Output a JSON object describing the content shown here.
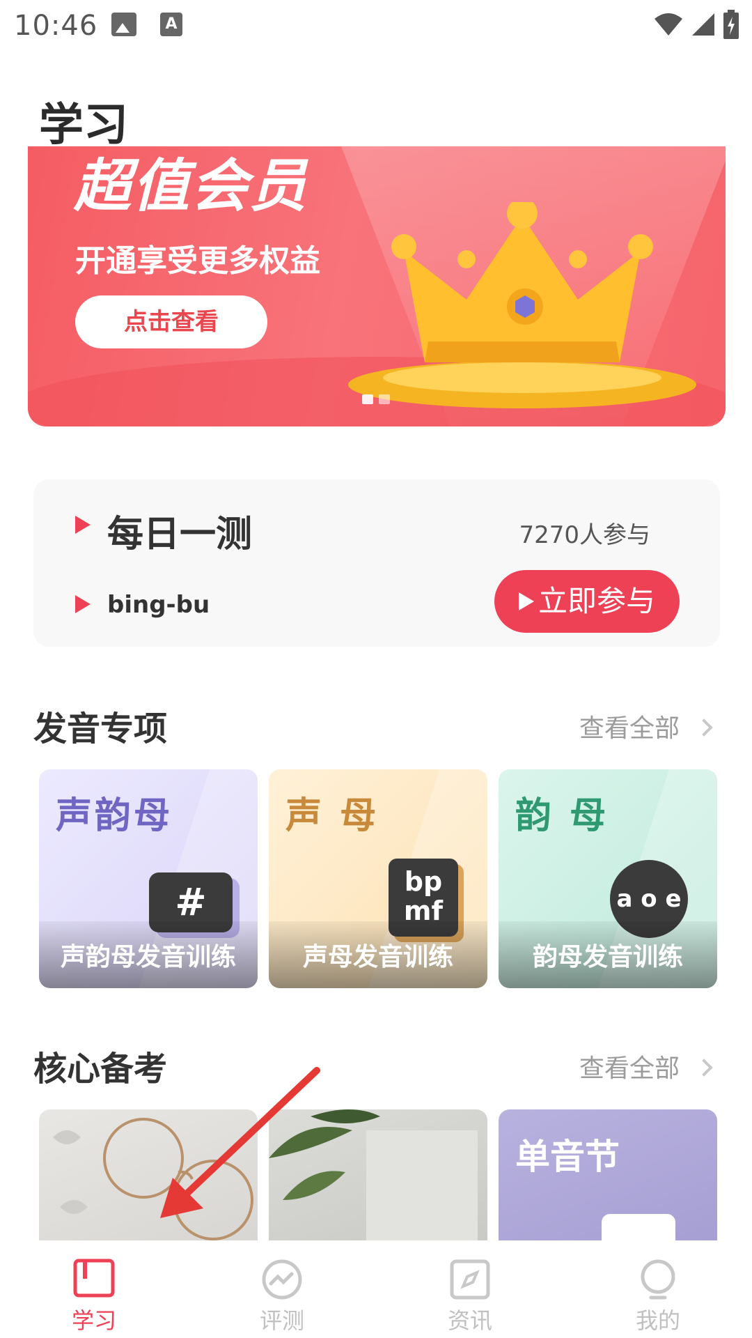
{
  "status_bar": {
    "time": "10:46"
  },
  "page": {
    "title": "学习"
  },
  "banner": {
    "headline": "超值会员",
    "subtitle": "开通享受更多权益",
    "button_label": "点击查看"
  },
  "daily_test": {
    "title": "每日一测",
    "participants": "7270人参与",
    "word": "bing-bu",
    "join_label": "立即参与"
  },
  "pronunciation": {
    "title": "发音专项",
    "more_label": "查看全部",
    "cards": [
      {
        "title": "声韵母",
        "badge": "#",
        "label": "声韵母发音训练"
      },
      {
        "title": "声 母",
        "badge_line1": "bp",
        "badge_line2": "mf",
        "label": "声母发音训练"
      },
      {
        "title": "韵 母",
        "badge": "a o e",
        "label": "韵母发音训练"
      }
    ]
  },
  "exam_prep": {
    "title": "核心备考",
    "more_label": "查看全部",
    "cards": [
      {
        "title": ""
      },
      {
        "title": ""
      },
      {
        "title": "单音节"
      }
    ]
  },
  "bottom_nav": {
    "items": [
      {
        "label": "学习",
        "icon": "study-book-icon",
        "active": true
      },
      {
        "label": "评测",
        "icon": "evaluation-chart-icon",
        "active": false
      },
      {
        "label": "资讯",
        "icon": "compass-news-icon",
        "active": false
      },
      {
        "label": "我的",
        "icon": "profile-bulb-icon",
        "active": false
      }
    ]
  },
  "colors": {
    "accent": "#ee4155",
    "banner": "#f55c63",
    "card_purple": "#d9d3f7",
    "card_orange": "#fde1b2",
    "card_green": "#bfeadb"
  }
}
